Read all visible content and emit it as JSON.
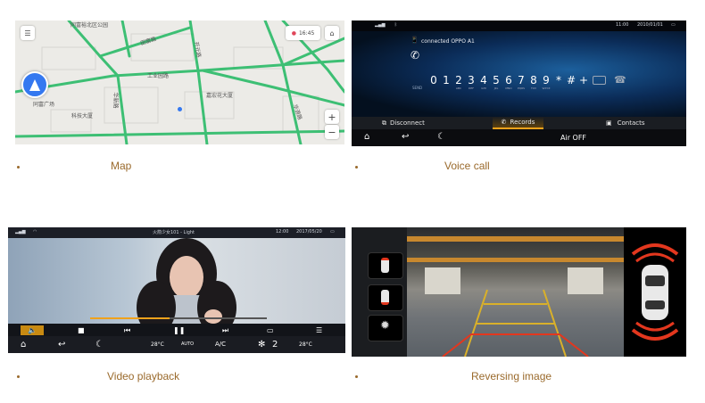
{
  "captions": {
    "map": "Map",
    "voice": "Voice call",
    "video": "Video playback",
    "reversing": "Reversing image"
  },
  "map": {
    "labels": [
      "同富裕北区公园",
      "田富路",
      "工业园路",
      "工业园路",
      "开元路",
      "嘉宏花大厦",
      "同富大道",
      "华源路",
      "科技大厦",
      "同富广场",
      "华新路",
      "同富路",
      "嘉宏路"
    ],
    "clock": "16:45",
    "zoom_in": "+",
    "zoom_out": "−",
    "menu_icon": "menu-icon",
    "home_icon": "home-icon",
    "nav_icon": "navigation-arrow-icon"
  },
  "voice": {
    "clock": "11:00",
    "date": "2010/01/01",
    "connected": "connected OPPO A1",
    "send_label": "SEND",
    "keys": [
      {
        "k": "0",
        "s": ""
      },
      {
        "k": "1",
        "s": ""
      },
      {
        "k": "2",
        "s": "ABC"
      },
      {
        "k": "3",
        "s": "DEF"
      },
      {
        "k": "4",
        "s": "GHI"
      },
      {
        "k": "5",
        "s": "JKL"
      },
      {
        "k": "6",
        "s": "MNO"
      },
      {
        "k": "7",
        "s": "PQRS"
      },
      {
        "k": "8",
        "s": "TUV"
      },
      {
        "k": "9",
        "s": "WXYZ"
      },
      {
        "k": "*",
        "s": ""
      },
      {
        "k": "#",
        "s": ""
      },
      {
        "k": "+",
        "s": ""
      }
    ],
    "tabs": {
      "disconnect": "Disconnect",
      "records": "Records",
      "contacts": "Contacts"
    },
    "air": "Air OFF",
    "accent": "#f0a21c"
  },
  "video": {
    "title": "火箭少女101 - Light",
    "clock": "12:00",
    "date": "2017/05/20",
    "temp_left": "28°C",
    "temp_right": "28°C",
    "auto": "AUTO",
    "ac": "A/C",
    "fan": "2",
    "progress": 0.45
  },
  "reversing": {
    "accent": "#e3371e"
  }
}
